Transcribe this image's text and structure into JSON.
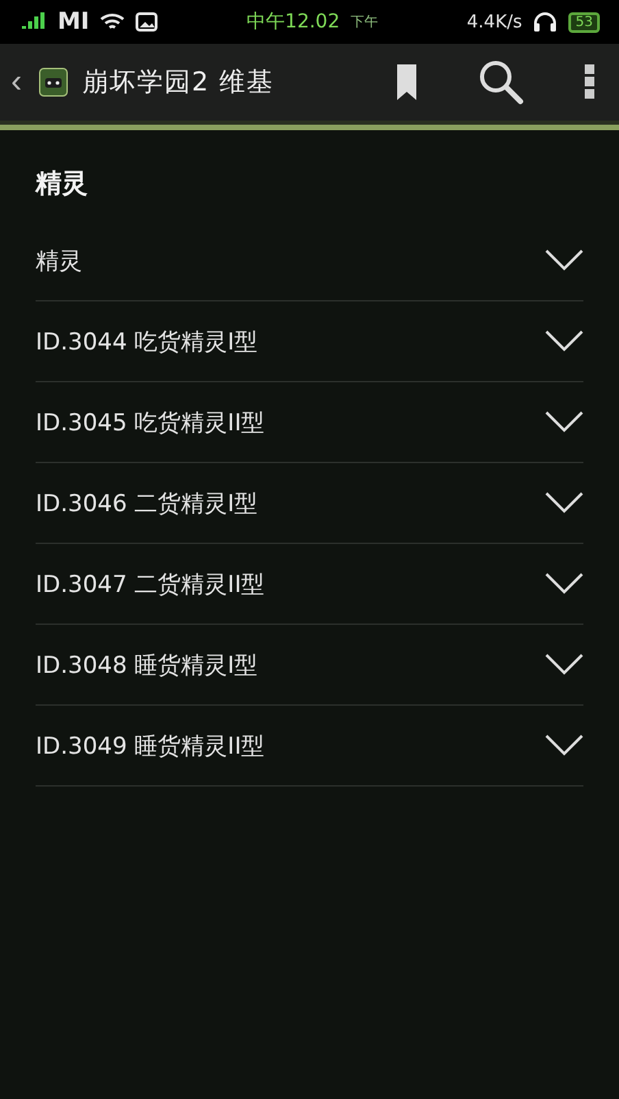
{
  "status_bar": {
    "carrier": "MI",
    "time": "中午12.02",
    "period": "下午",
    "speed": "4.4K/s",
    "battery": "53"
  },
  "app_bar": {
    "back": "‹",
    "title": "崩坏学园2 维基"
  },
  "section": {
    "heading": "精灵",
    "rows": [
      {
        "label": "精灵",
        "expanded": false
      },
      {
        "label": "ID.3044 吃货精灵I型",
        "expanded": false
      },
      {
        "label": "ID.3045 吃货精灵II型",
        "expanded": false
      },
      {
        "label": "ID.3046 二货精灵I型",
        "expanded": false
      },
      {
        "label": "ID.3047 二货精灵II型",
        "expanded": false
      },
      {
        "label": "ID.3048 睡货精灵I型",
        "expanded": false
      },
      {
        "label": "ID.3049 睡货精灵II型",
        "expanded": false
      }
    ]
  }
}
